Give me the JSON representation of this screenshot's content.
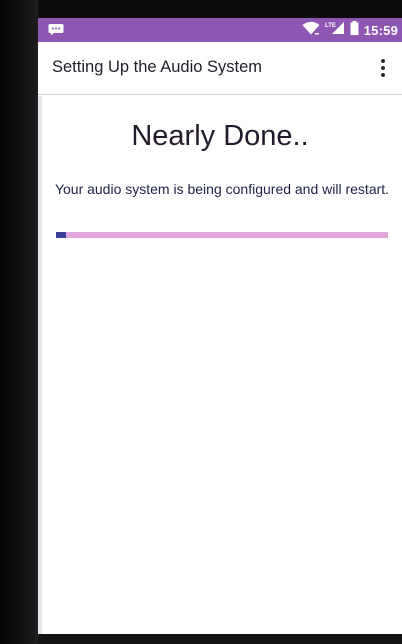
{
  "status_bar": {
    "time": "15:59",
    "left_icon": "message-icon",
    "icons": [
      "wifi-icon",
      "lte-signal-icon",
      "battery-icon"
    ],
    "network_label": "LTE",
    "color": "#8e56b3"
  },
  "app_bar": {
    "title": "Setting Up the Audio System",
    "menu_icon": "more-vert-icon"
  },
  "content": {
    "heading": "Nearly Done..",
    "message": "Your audio system is being configured and will restart.",
    "progress": 0.03,
    "progress_color": "#3b3f97",
    "progress_track_color": "#e2a7d8"
  }
}
